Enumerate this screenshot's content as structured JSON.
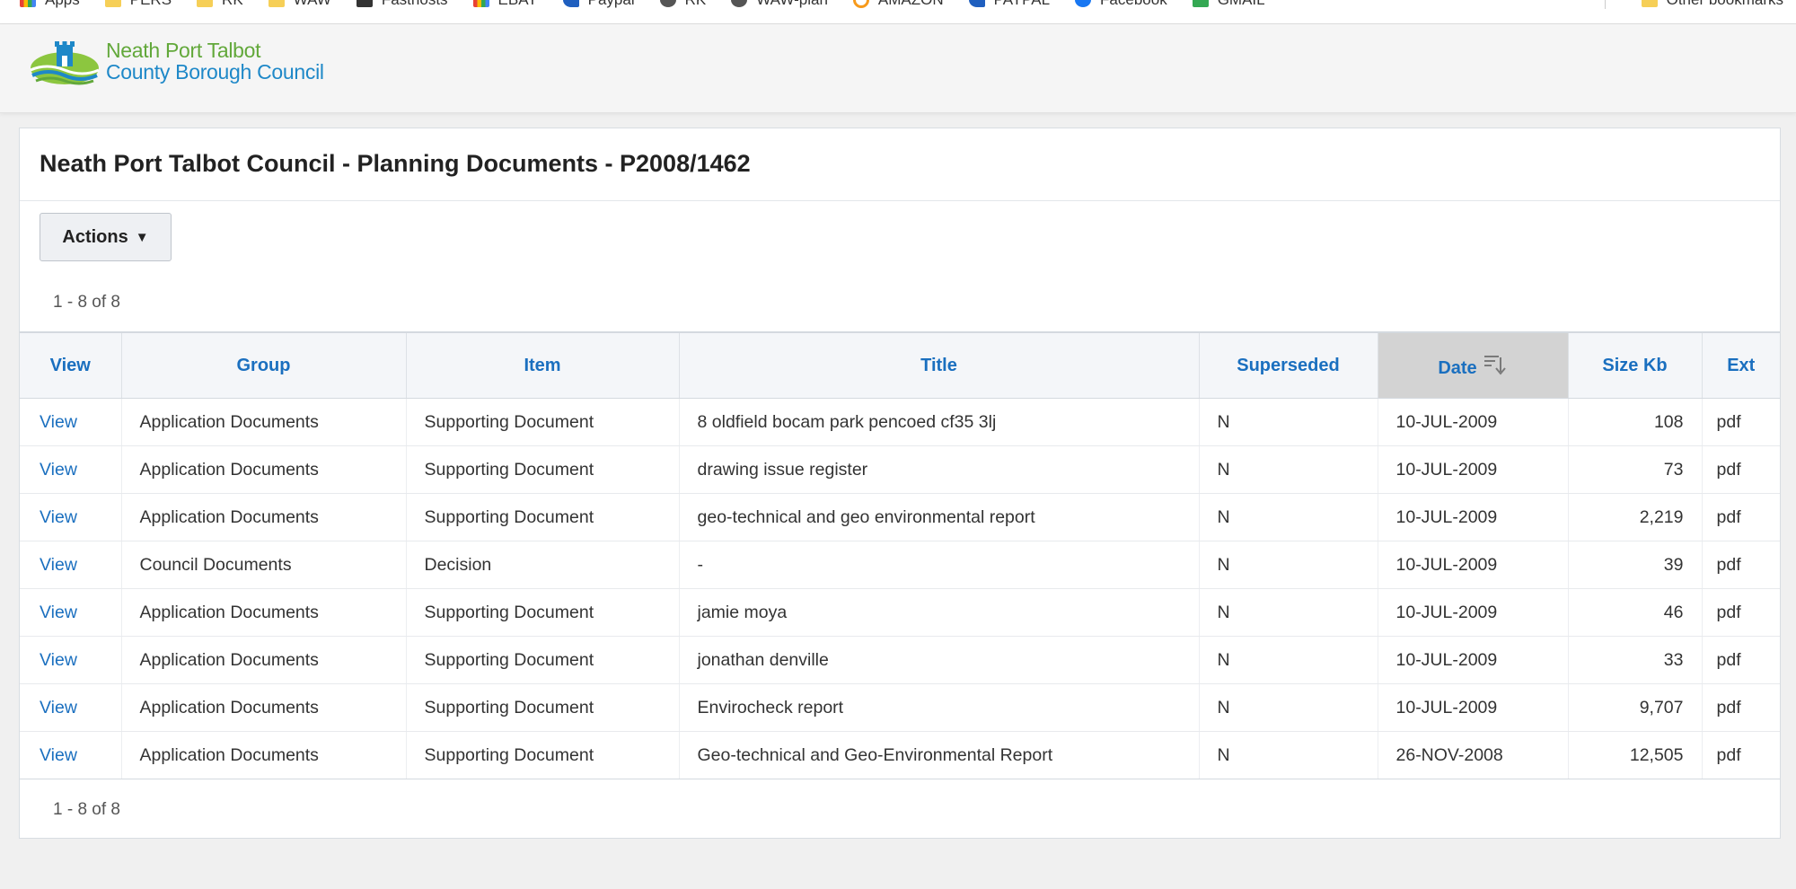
{
  "bookmarks": {
    "items": [
      {
        "label": "Apps",
        "icon": "apps-grid-icon"
      },
      {
        "label": "PERS",
        "icon": "folder-icon"
      },
      {
        "label": "RK",
        "icon": "folder-icon"
      },
      {
        "label": "WAW",
        "icon": "folder-icon"
      },
      {
        "label": "Fasthosts",
        "icon": "fasthosts-icon"
      },
      {
        "label": "EBAY",
        "icon": "ebay-icon"
      },
      {
        "label": "Paypal",
        "icon": "paypal-icon"
      },
      {
        "label": "RK",
        "icon": "globe-icon"
      },
      {
        "label": "WAW-plan",
        "icon": "globe-icon"
      },
      {
        "label": "AMAZON",
        "icon": "amazon-icon"
      },
      {
        "label": "PAYPAL",
        "icon": "paypal-icon"
      },
      {
        "label": "Facebook",
        "icon": "facebook-icon"
      },
      {
        "label": "GMAIL",
        "icon": "gmail-icon"
      }
    ],
    "other": "Other bookmarks"
  },
  "header": {
    "logo_line1": "Neath Port Talbot",
    "logo_line2": "County Borough Council"
  },
  "panel": {
    "title": "Neath Port Talbot Council - Planning Documents - P2008/1462",
    "actions_label": "Actions",
    "range_top": "1 - 8 of 8",
    "range_bottom": "1 - 8 of 8"
  },
  "table": {
    "columns": [
      "View",
      "Group",
      "Item",
      "Title",
      "Superseded",
      "Date",
      "Size Kb",
      "Ext"
    ],
    "sorted_column": "Date",
    "rows": [
      {
        "view": "View",
        "group": "Application Documents",
        "item": "Supporting Document",
        "title": "8 oldfield bocam park pencoed cf35 3lj",
        "superseded": "N",
        "date": "10-JUL-2009",
        "size": "108",
        "ext": "pdf"
      },
      {
        "view": "View",
        "group": "Application Documents",
        "item": "Supporting Document",
        "title": "drawing issue register",
        "superseded": "N",
        "date": "10-JUL-2009",
        "size": "73",
        "ext": "pdf"
      },
      {
        "view": "View",
        "group": "Application Documents",
        "item": "Supporting Document",
        "title": "geo-technical and geo environmental report",
        "superseded": "N",
        "date": "10-JUL-2009",
        "size": "2,219",
        "ext": "pdf"
      },
      {
        "view": "View",
        "group": "Council Documents",
        "item": "Decision",
        "title": "-",
        "superseded": "N",
        "date": "10-JUL-2009",
        "size": "39",
        "ext": "pdf"
      },
      {
        "view": "View",
        "group": "Application Documents",
        "item": "Supporting Document",
        "title": "jamie moya",
        "superseded": "N",
        "date": "10-JUL-2009",
        "size": "46",
        "ext": "pdf"
      },
      {
        "view": "View",
        "group": "Application Documents",
        "item": "Supporting Document",
        "title": "jonathan denville",
        "superseded": "N",
        "date": "10-JUL-2009",
        "size": "33",
        "ext": "pdf"
      },
      {
        "view": "View",
        "group": "Application Documents",
        "item": "Supporting Document",
        "title": "Envirocheck report",
        "superseded": "N",
        "date": "10-JUL-2009",
        "size": "9,707",
        "ext": "pdf"
      },
      {
        "view": "View",
        "group": "Application Documents",
        "item": "Supporting Document",
        "title": "Geo-technical and Geo-Environmental Report",
        "superseded": "N",
        "date": "26-NOV-2008",
        "size": "12,505",
        "ext": "pdf"
      }
    ]
  },
  "colors": {
    "link": "#1a6fbf",
    "logo_green": "#62a83a",
    "logo_blue": "#1e88c8",
    "sorted_header": "#d3d3d3"
  }
}
